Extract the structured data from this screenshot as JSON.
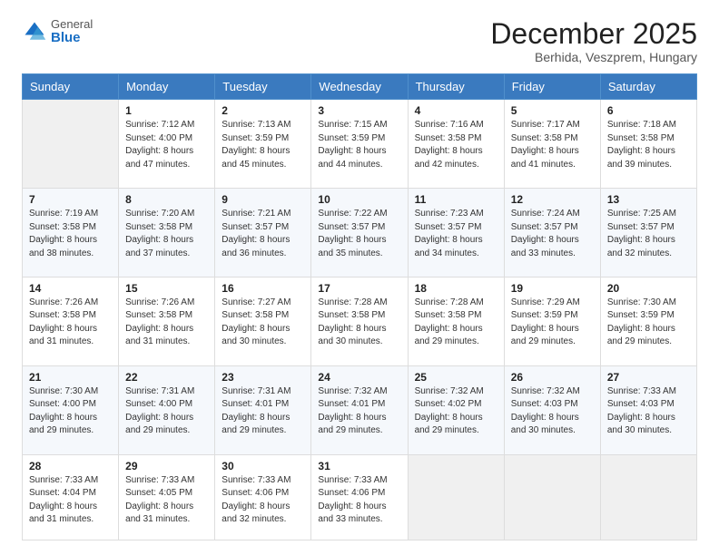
{
  "header": {
    "logo_general": "General",
    "logo_blue": "Blue",
    "month_title": "December 2025",
    "location": "Berhida, Veszprem, Hungary"
  },
  "days_of_week": [
    "Sunday",
    "Monday",
    "Tuesday",
    "Wednesday",
    "Thursday",
    "Friday",
    "Saturday"
  ],
  "weeks": [
    [
      {
        "day": "",
        "info": ""
      },
      {
        "day": "1",
        "info": "Sunrise: 7:12 AM\nSunset: 4:00 PM\nDaylight: 8 hours\nand 47 minutes."
      },
      {
        "day": "2",
        "info": "Sunrise: 7:13 AM\nSunset: 3:59 PM\nDaylight: 8 hours\nand 45 minutes."
      },
      {
        "day": "3",
        "info": "Sunrise: 7:15 AM\nSunset: 3:59 PM\nDaylight: 8 hours\nand 44 minutes."
      },
      {
        "day": "4",
        "info": "Sunrise: 7:16 AM\nSunset: 3:58 PM\nDaylight: 8 hours\nand 42 minutes."
      },
      {
        "day": "5",
        "info": "Sunrise: 7:17 AM\nSunset: 3:58 PM\nDaylight: 8 hours\nand 41 minutes."
      },
      {
        "day": "6",
        "info": "Sunrise: 7:18 AM\nSunset: 3:58 PM\nDaylight: 8 hours\nand 39 minutes."
      }
    ],
    [
      {
        "day": "7",
        "info": "Sunrise: 7:19 AM\nSunset: 3:58 PM\nDaylight: 8 hours\nand 38 minutes."
      },
      {
        "day": "8",
        "info": "Sunrise: 7:20 AM\nSunset: 3:58 PM\nDaylight: 8 hours\nand 37 minutes."
      },
      {
        "day": "9",
        "info": "Sunrise: 7:21 AM\nSunset: 3:57 PM\nDaylight: 8 hours\nand 36 minutes."
      },
      {
        "day": "10",
        "info": "Sunrise: 7:22 AM\nSunset: 3:57 PM\nDaylight: 8 hours\nand 35 minutes."
      },
      {
        "day": "11",
        "info": "Sunrise: 7:23 AM\nSunset: 3:57 PM\nDaylight: 8 hours\nand 34 minutes."
      },
      {
        "day": "12",
        "info": "Sunrise: 7:24 AM\nSunset: 3:57 PM\nDaylight: 8 hours\nand 33 minutes."
      },
      {
        "day": "13",
        "info": "Sunrise: 7:25 AM\nSunset: 3:57 PM\nDaylight: 8 hours\nand 32 minutes."
      }
    ],
    [
      {
        "day": "14",
        "info": "Sunrise: 7:26 AM\nSunset: 3:58 PM\nDaylight: 8 hours\nand 31 minutes."
      },
      {
        "day": "15",
        "info": "Sunrise: 7:26 AM\nSunset: 3:58 PM\nDaylight: 8 hours\nand 31 minutes."
      },
      {
        "day": "16",
        "info": "Sunrise: 7:27 AM\nSunset: 3:58 PM\nDaylight: 8 hours\nand 30 minutes."
      },
      {
        "day": "17",
        "info": "Sunrise: 7:28 AM\nSunset: 3:58 PM\nDaylight: 8 hours\nand 30 minutes."
      },
      {
        "day": "18",
        "info": "Sunrise: 7:28 AM\nSunset: 3:58 PM\nDaylight: 8 hours\nand 29 minutes."
      },
      {
        "day": "19",
        "info": "Sunrise: 7:29 AM\nSunset: 3:59 PM\nDaylight: 8 hours\nand 29 minutes."
      },
      {
        "day": "20",
        "info": "Sunrise: 7:30 AM\nSunset: 3:59 PM\nDaylight: 8 hours\nand 29 minutes."
      }
    ],
    [
      {
        "day": "21",
        "info": "Sunrise: 7:30 AM\nSunset: 4:00 PM\nDaylight: 8 hours\nand 29 minutes."
      },
      {
        "day": "22",
        "info": "Sunrise: 7:31 AM\nSunset: 4:00 PM\nDaylight: 8 hours\nand 29 minutes."
      },
      {
        "day": "23",
        "info": "Sunrise: 7:31 AM\nSunset: 4:01 PM\nDaylight: 8 hours\nand 29 minutes."
      },
      {
        "day": "24",
        "info": "Sunrise: 7:32 AM\nSunset: 4:01 PM\nDaylight: 8 hours\nand 29 minutes."
      },
      {
        "day": "25",
        "info": "Sunrise: 7:32 AM\nSunset: 4:02 PM\nDaylight: 8 hours\nand 29 minutes."
      },
      {
        "day": "26",
        "info": "Sunrise: 7:32 AM\nSunset: 4:03 PM\nDaylight: 8 hours\nand 30 minutes."
      },
      {
        "day": "27",
        "info": "Sunrise: 7:33 AM\nSunset: 4:03 PM\nDaylight: 8 hours\nand 30 minutes."
      }
    ],
    [
      {
        "day": "28",
        "info": "Sunrise: 7:33 AM\nSunset: 4:04 PM\nDaylight: 8 hours\nand 31 minutes."
      },
      {
        "day": "29",
        "info": "Sunrise: 7:33 AM\nSunset: 4:05 PM\nDaylight: 8 hours\nand 31 minutes."
      },
      {
        "day": "30",
        "info": "Sunrise: 7:33 AM\nSunset: 4:06 PM\nDaylight: 8 hours\nand 32 minutes."
      },
      {
        "day": "31",
        "info": "Sunrise: 7:33 AM\nSunset: 4:06 PM\nDaylight: 8 hours\nand 33 minutes."
      },
      {
        "day": "",
        "info": ""
      },
      {
        "day": "",
        "info": ""
      },
      {
        "day": "",
        "info": ""
      }
    ]
  ]
}
